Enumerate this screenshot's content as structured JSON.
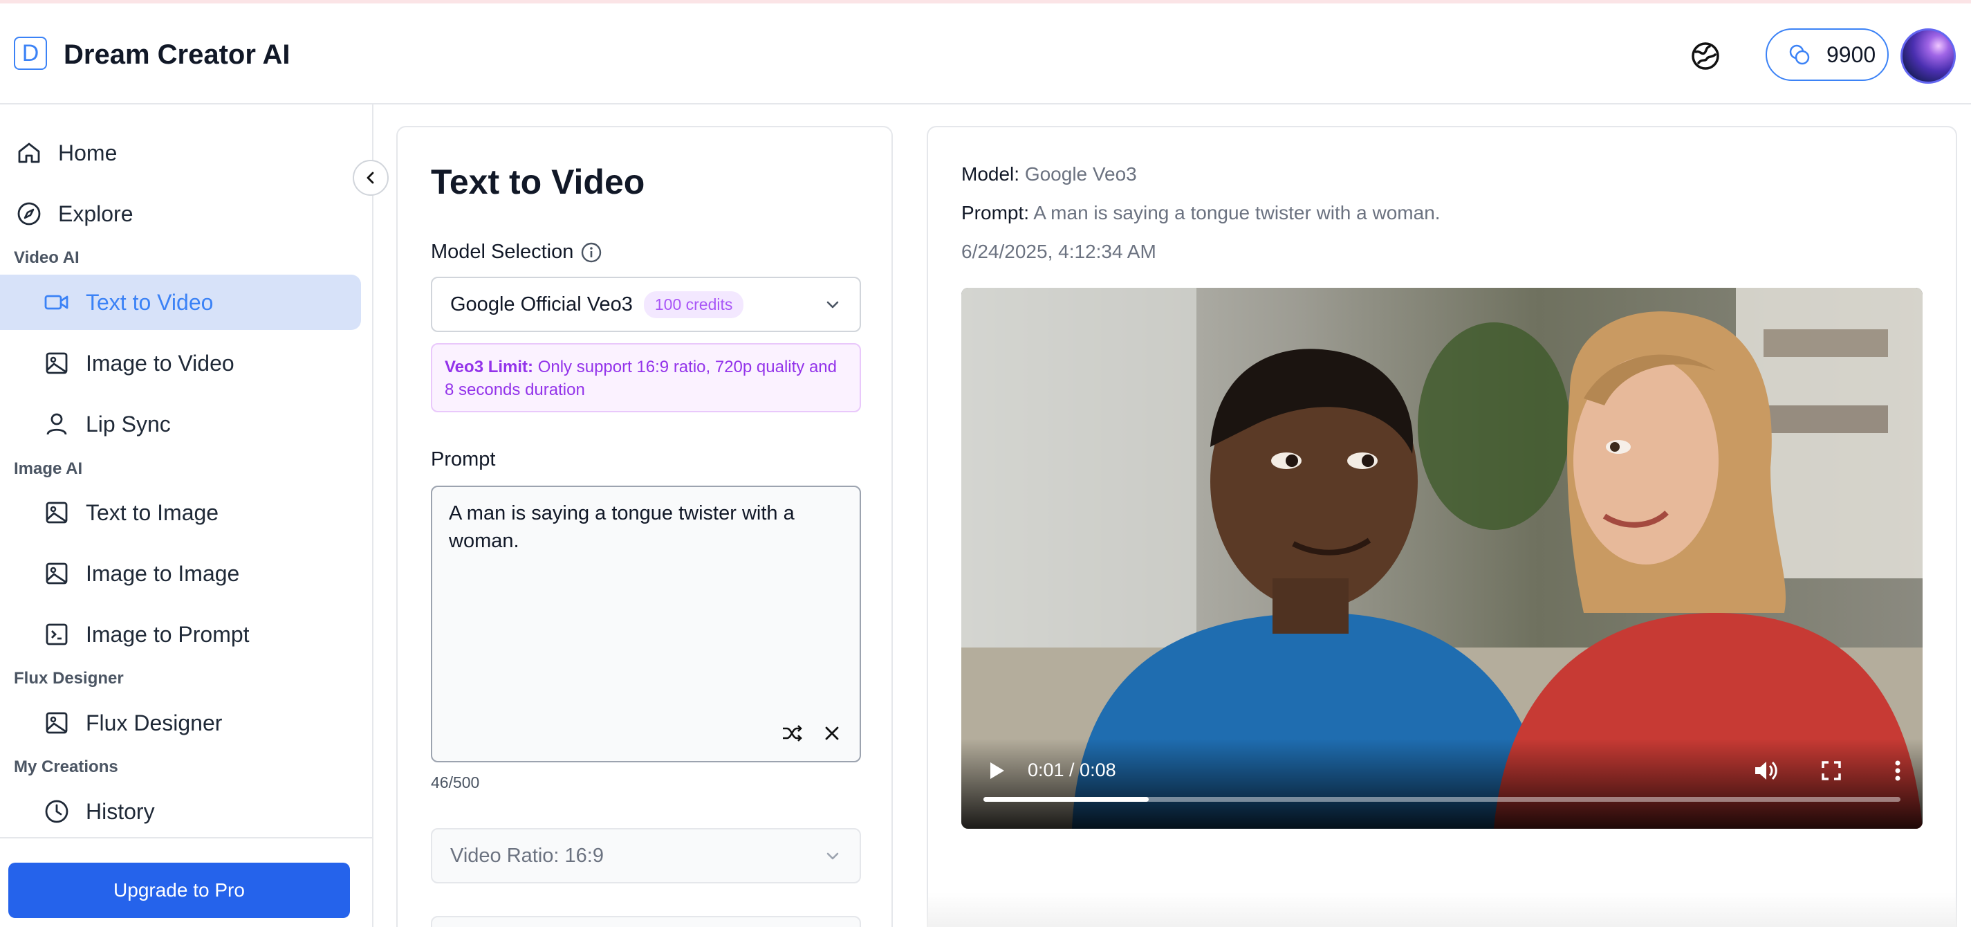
{
  "app": {
    "logo_letter": "D",
    "title": "Dream Creator AI",
    "credits": "9900",
    "accent_color": "#3b82f6"
  },
  "sidebar": {
    "home": "Home",
    "explore": "Explore",
    "sections": [
      {
        "label": "Video AI",
        "items": [
          {
            "label": "Text to Video",
            "icon": "video-camera-icon",
            "active": true
          },
          {
            "label": "Image to Video",
            "icon": "image-icon"
          },
          {
            "label": "Lip Sync",
            "icon": "user-icon"
          }
        ]
      },
      {
        "label": "Image AI",
        "items": [
          {
            "label": "Text to Image",
            "icon": "image-icon"
          },
          {
            "label": "Image to Image",
            "icon": "image-icon"
          },
          {
            "label": "Image to Prompt",
            "icon": "terminal-icon"
          }
        ]
      },
      {
        "label": "Flux Designer",
        "items": [
          {
            "label": "Flux Designer",
            "icon": "image-icon"
          }
        ]
      },
      {
        "label": "My Creations",
        "items": [
          {
            "label": "History",
            "icon": "clock-icon"
          }
        ]
      }
    ],
    "upgrade": "Upgrade to Pro"
  },
  "form": {
    "title": "Text to Video",
    "model_label": "Model Selection",
    "model_value": "Google Official Veo3",
    "model_credits": "100 credits",
    "limit_title": "Veo3 Limit:",
    "limit_text": "Only support 16:9 ratio, 720p quality and 8 seconds duration",
    "prompt_label": "Prompt",
    "prompt_value": "A man is saying a tongue twister with a woman.",
    "counter": "46/500",
    "ratio": "Video Ratio: 16:9"
  },
  "result": {
    "model_key": "Model:",
    "model_value": "Google Veo3",
    "prompt_key": "Prompt:",
    "prompt_value": "A man is saying a tongue twister with a woman.",
    "timestamp": "6/24/2025, 4:12:34 AM",
    "video_time": "0:01 / 0:08",
    "progress": 0.18
  }
}
